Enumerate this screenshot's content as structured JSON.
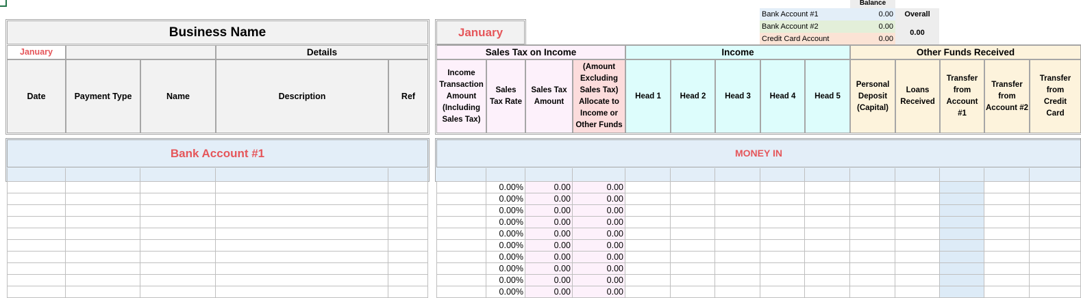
{
  "summary": {
    "balance_label": "Balance",
    "accounts": [
      {
        "name": "Bank Account #1",
        "value": "0.00"
      },
      {
        "name": "Bank Account #2",
        "value": "0.00"
      },
      {
        "name": "Credit Card Account",
        "value": "0.00"
      }
    ],
    "overall_label": "Overall",
    "overall_value": "0.00"
  },
  "left": {
    "business_name": "Business Name",
    "month": "January",
    "details_label": "Details",
    "columns": [
      "Date",
      "Payment Type",
      "Name",
      "Description",
      "Ref"
    ],
    "account_title": "Bank Account #1"
  },
  "right": {
    "month": "January",
    "groups": {
      "sales_tax": "Sales Tax on Income",
      "income": "Income",
      "other_funds": "Other Funds Received"
    },
    "columns": {
      "income_amount": "Income Transaction Amount (Including Sales Tax)",
      "tax_rate": "Sales Tax Rate",
      "tax_amount": "Sales Tax Amount",
      "allocate": "(Amount Excluding Sales Tax) Allocate to Income or Other Funds",
      "heads": [
        "Head 1",
        "Head 2",
        "Head 3",
        "Head 4",
        "Head 5"
      ],
      "personal_deposit": "Personal Deposit (Capital)",
      "loans": "Loans Received",
      "transfer_1": "Transfer from Account #1",
      "transfer_2": "Transfer from Account #2",
      "transfer_cc": "Transfer from Credit Card"
    },
    "money_in": "MONEY IN"
  },
  "rows": [
    {
      "rate": "0.00%",
      "tax": "0.00",
      "alloc": "0.00"
    },
    {
      "rate": "0.00%",
      "tax": "0.00",
      "alloc": "0.00"
    },
    {
      "rate": "0.00%",
      "tax": "0.00",
      "alloc": "0.00"
    },
    {
      "rate": "0.00%",
      "tax": "0.00",
      "alloc": "0.00"
    },
    {
      "rate": "0.00%",
      "tax": "0.00",
      "alloc": "0.00"
    },
    {
      "rate": "0.00%",
      "tax": "0.00",
      "alloc": "0.00"
    },
    {
      "rate": "0.00%",
      "tax": "0.00",
      "alloc": "0.00"
    },
    {
      "rate": "0.00%",
      "tax": "0.00",
      "alloc": "0.00"
    },
    {
      "rate": "0.00%",
      "tax": "0.00",
      "alloc": "0.00"
    },
    {
      "rate": "0.00%",
      "tax": "0.00",
      "alloc": "0.00"
    }
  ]
}
